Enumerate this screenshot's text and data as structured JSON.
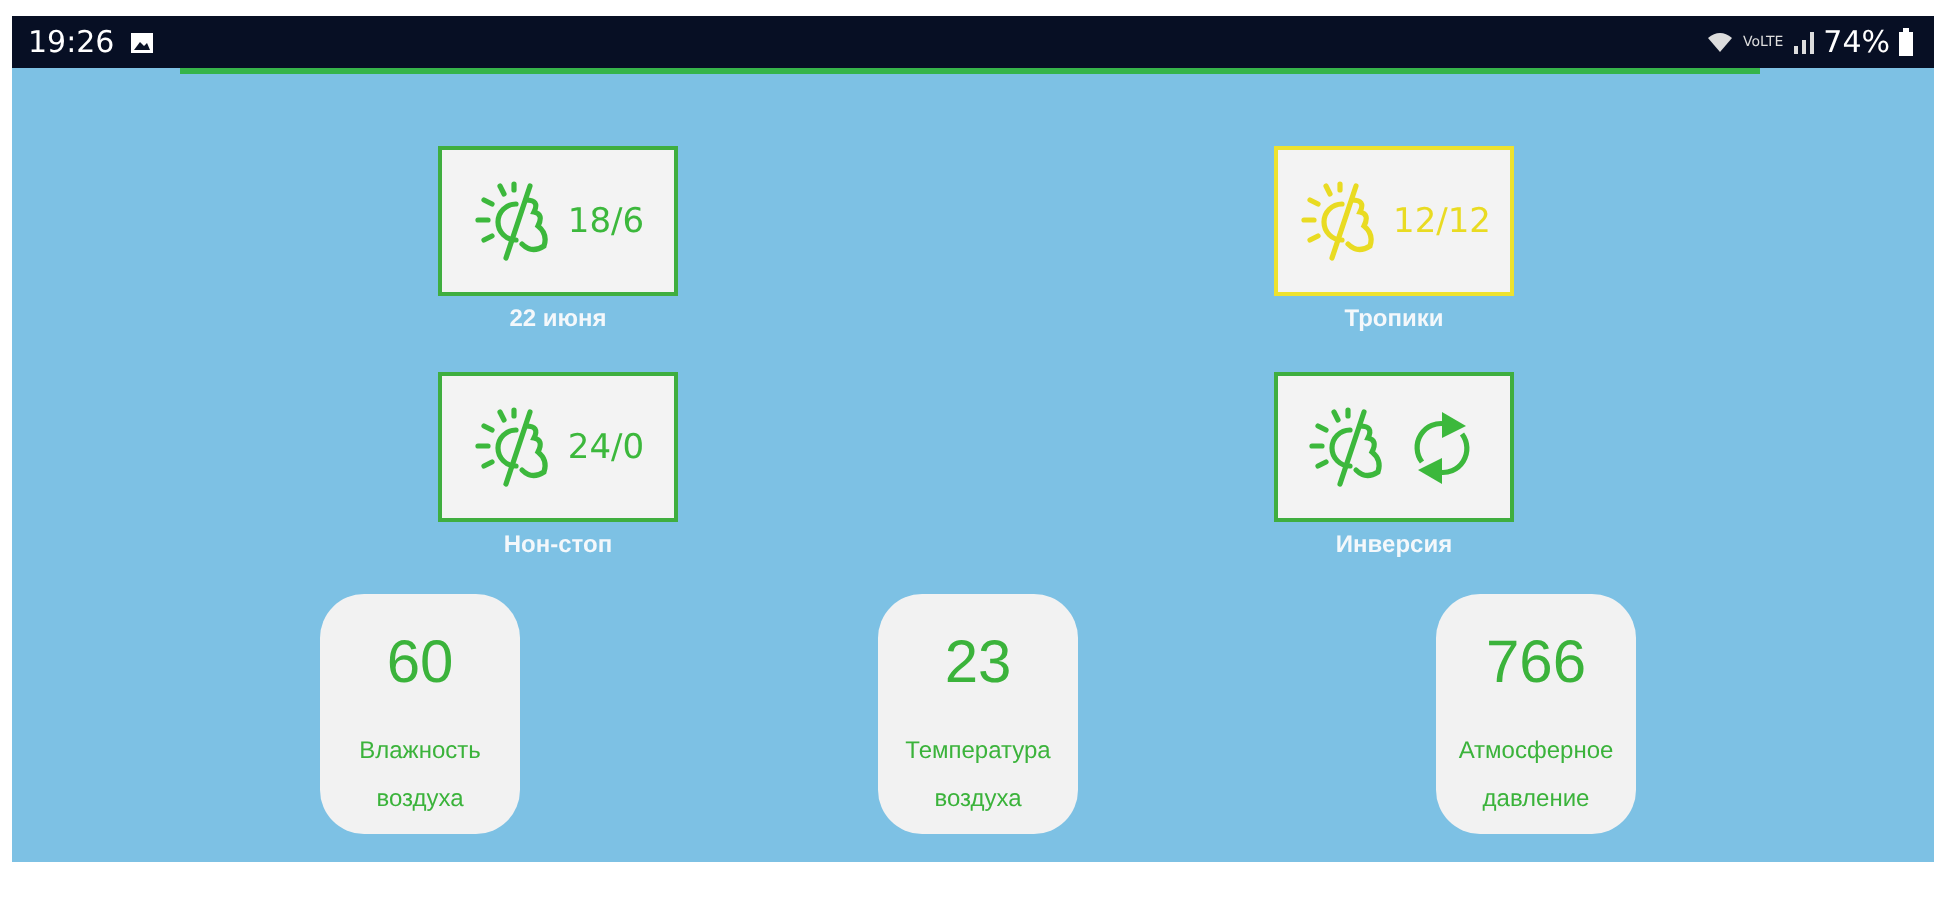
{
  "status_bar": {
    "time": "19:26",
    "network": "VoLTE",
    "battery": "74%"
  },
  "modes": [
    {
      "kind": "ratio",
      "value": "18/6",
      "label": "22 июня",
      "selected": false
    },
    {
      "kind": "ratio",
      "value": "12/12",
      "label": "Тропики",
      "selected": true
    },
    {
      "kind": "ratio",
      "value": "24/0",
      "label": "Нон-стоп",
      "selected": false
    },
    {
      "kind": "inversion",
      "label": "Инверсия",
      "selected": false
    }
  ],
  "sensors": [
    {
      "value": "60",
      "label": "Влажность воздуха"
    },
    {
      "value": "23",
      "label": "Температура воздуха"
    },
    {
      "value": "766",
      "label": "Атмосферное давление"
    }
  ]
}
